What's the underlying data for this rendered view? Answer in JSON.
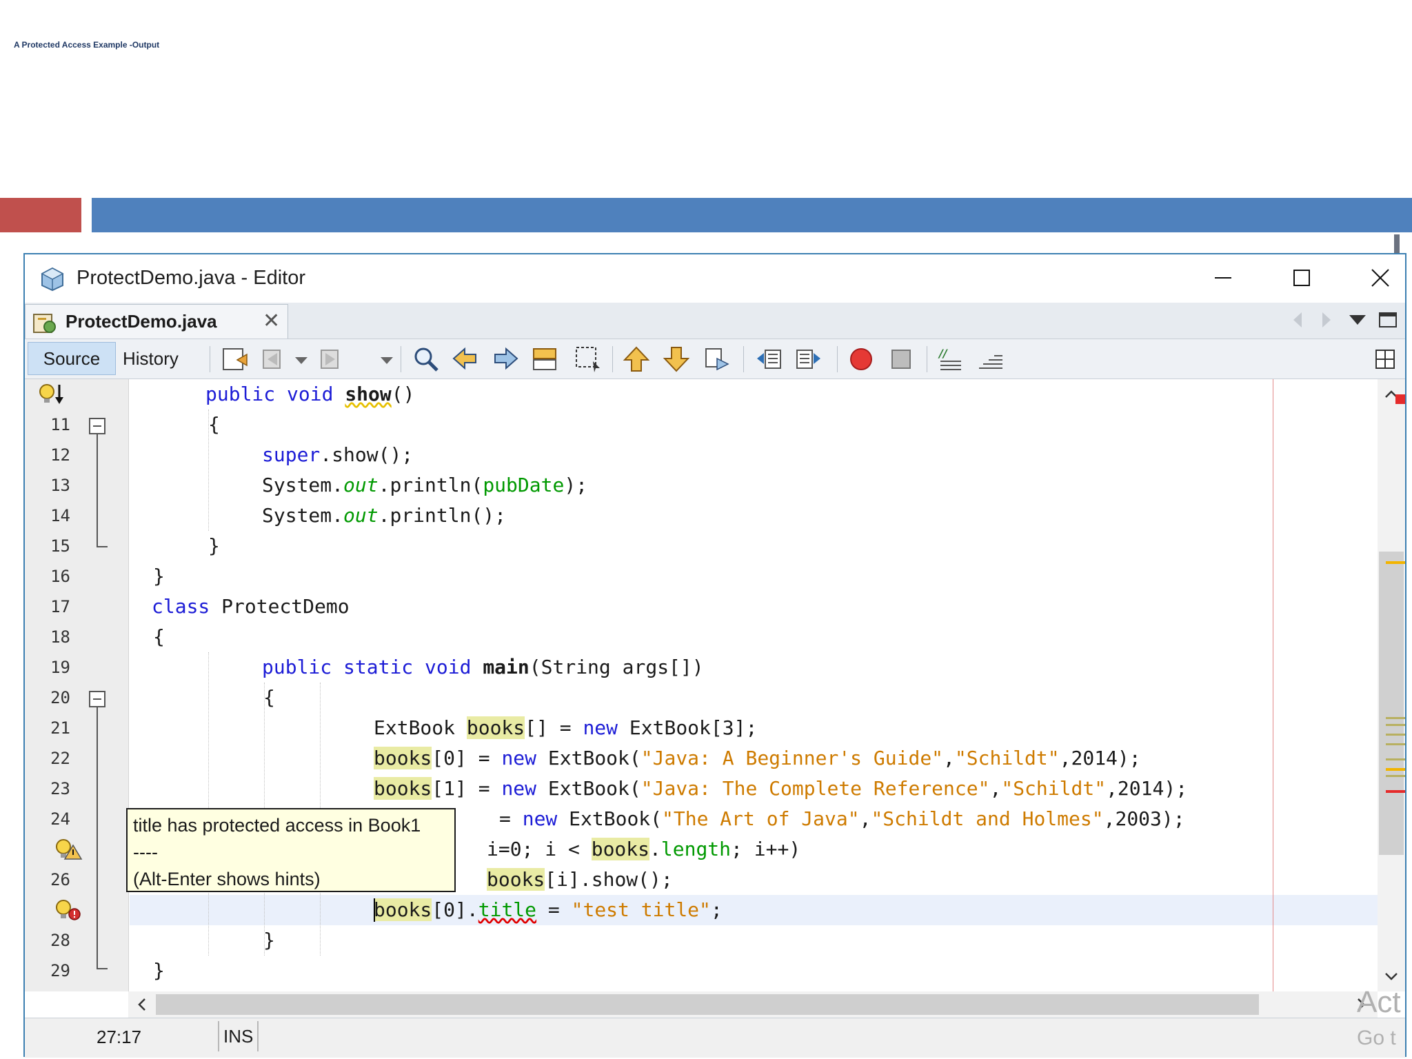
{
  "slide": {
    "title": "A Protected Access Example -Output"
  },
  "window": {
    "title": "ProtectDemo.java - Editor",
    "controls": [
      "minimize",
      "maximize",
      "close"
    ]
  },
  "file_tab": {
    "label": "ProtectDemo.java",
    "close": "✕"
  },
  "toolbar": {
    "source_label": "Source",
    "history_label": "History"
  },
  "editor": {
    "line_numbers": [
      "",
      "11",
      "12",
      "13",
      "14",
      "15",
      "16",
      "17",
      "18",
      "19",
      "20",
      "21",
      "22",
      "23",
      "24",
      "",
      "26",
      "",
      "28",
      "29"
    ],
    "caret_line": "27",
    "highlighted_line": "27"
  },
  "code": {
    "l10": [
      "public",
      "void",
      "show",
      "()"
    ],
    "l11": "{",
    "l12": [
      "super",
      ".show();"
    ],
    "l13": [
      "System.",
      "out",
      ".println(",
      "pubDate",
      ");"
    ],
    "l14": [
      "System.",
      "out",
      ".println();"
    ],
    "l15": "}",
    "l16": "}",
    "l17": [
      "class",
      "ProtectDemo"
    ],
    "l18": "{",
    "l19": [
      "public",
      "static",
      "void",
      "main",
      "(String args[])"
    ],
    "l20": "{",
    "l21": [
      "ExtBook ",
      "books",
      "[] = ",
      "new",
      " ExtBook[3];"
    ],
    "l22": [
      "books",
      "[0] = ",
      "new",
      " ExtBook(",
      "\"Java: A Beginner's Guide\"",
      ",",
      "\"Schildt\"",
      ",2014);"
    ],
    "l23": [
      "books",
      "[1] = ",
      "new",
      " ExtBook(",
      "\"Java: The Complete Reference\"",
      ",",
      "\"Schildt\"",
      ",2014);"
    ],
    "l24": [
      "= ",
      "new",
      " ExtBook(",
      "\"The Art of Java\"",
      ",",
      "\"Schildt and Holmes\"",
      ",2003);"
    ],
    "l25": [
      "i=0; i < ",
      "books",
      ".",
      "length",
      "; i++)"
    ],
    "l26": [
      "books",
      "[i].show();"
    ],
    "l27": [
      "books",
      "[0].",
      "title",
      " = ",
      "\"test title\"",
      ";"
    ],
    "l28": "}",
    "l29": "}"
  },
  "tooltip": {
    "line1": "title has protected access in Book1",
    "line2": "----",
    "line3": "(Alt-Enter shows hints)"
  },
  "status": {
    "position": "27:17",
    "mode": "INS"
  },
  "watermark": {
    "line1": "Act",
    "line2": "Go t"
  },
  "colors": {
    "keyword": "#1c1cd6",
    "string": "#ce7b00",
    "field": "#009900",
    "accent_blue": "#4f81bd",
    "accent_red": "#c0504d",
    "tooltip_bg": "#ffffe1"
  },
  "icons": [
    "netbeans-app-icon",
    "java-file-icon",
    "go-back-icon",
    "find-icon",
    "bookmark-icon",
    "breakpoint-icon",
    "stop-icon",
    "diff-icon",
    "hint-bulb-icon",
    "error-bulb-icon"
  ]
}
